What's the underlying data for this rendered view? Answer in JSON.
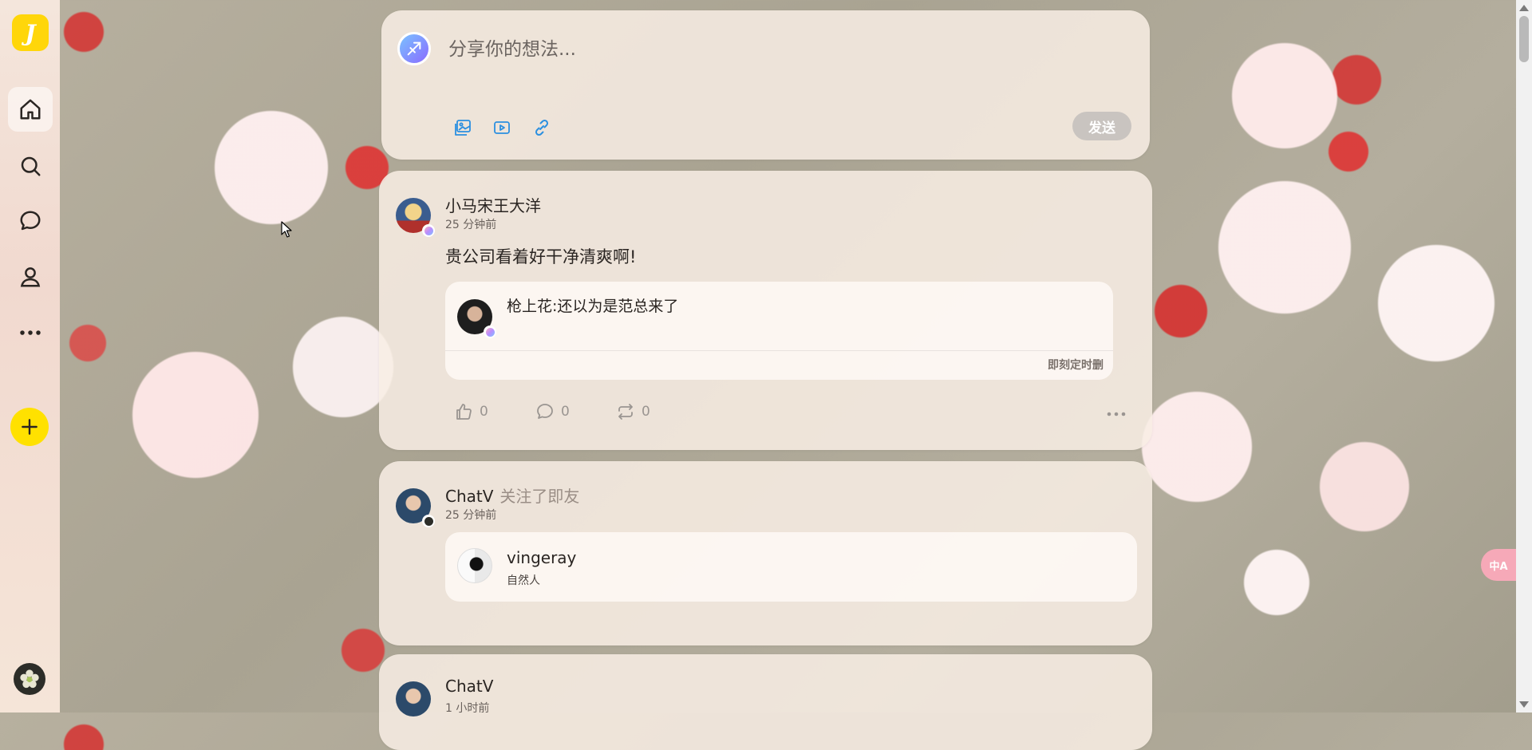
{
  "nav": {
    "logo_letter": "J",
    "items": [
      "home-icon",
      "search-icon",
      "chat-icon",
      "user-icon",
      "more-icon"
    ],
    "add_label": "+"
  },
  "composer": {
    "placeholder": "分享你的想法...",
    "tools": [
      "image-icon",
      "video-icon",
      "link-icon"
    ],
    "send_label": "发送"
  },
  "posts": [
    {
      "author": "小马宋王大洋",
      "time": "25 分钟前",
      "content": "贵公司看着好干净清爽啊!",
      "quote": {
        "text": "枪上花:还以为是范总来了",
        "footer": "即刻定时删"
      },
      "actions": {
        "like": "0",
        "comment": "0",
        "repost": "0"
      }
    },
    {
      "author": "ChatV",
      "follow_text": "关注了即友",
      "time": "25 分钟前",
      "followed_user": {
        "name": "vingeray",
        "bio": "自然人"
      }
    },
    {
      "author": "ChatV",
      "time": "1 小时前"
    }
  ],
  "translate_label": "中A",
  "colors": {
    "accent": "#ffe100",
    "logo": "#ffd60a",
    "link": "#2b8fe0"
  }
}
